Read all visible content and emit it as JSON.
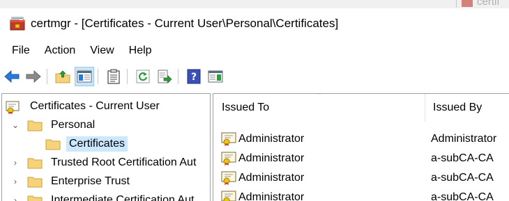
{
  "background_window": {
    "title_fragment": "certif"
  },
  "window": {
    "title": "certmgr - [Certificates - Current User\\Personal\\Certificates]"
  },
  "menu": [
    "File",
    "Action",
    "View",
    "Help"
  ],
  "toolbar": {
    "icons": [
      "back-arrow-icon",
      "forward-arrow-icon",
      "up-folder-icon",
      "show-hide-console-tree-icon",
      "properties-icon",
      "refresh-icon",
      "export-list-icon",
      "help-icon",
      "show-action-pane-icon"
    ],
    "pressed": "show-hide-console-tree-icon"
  },
  "tree": {
    "root": "Certificates - Current User",
    "items": [
      {
        "label": "Personal",
        "expanded": true
      },
      {
        "label": "Certificates",
        "selected": true
      },
      {
        "label": "Trusted Root Certification Aut"
      },
      {
        "label": "Enterprise Trust"
      },
      {
        "label": "Intermediate Certification Aut"
      }
    ]
  },
  "list": {
    "columns": [
      "Issued To",
      "Issued By"
    ],
    "rows": [
      [
        "Administrator",
        "Administrator"
      ],
      [
        "Administrator",
        "a-subCA-CA"
      ],
      [
        "Administrator",
        "a-subCA-CA"
      ],
      [
        "Administrator",
        "a-subCA-CA"
      ]
    ]
  },
  "colors": {
    "selection": "#cce8ff",
    "toolbar_pressed": "#cce4f7",
    "folder": "#f6d37a",
    "arrow_blue": "#2b79d6"
  }
}
